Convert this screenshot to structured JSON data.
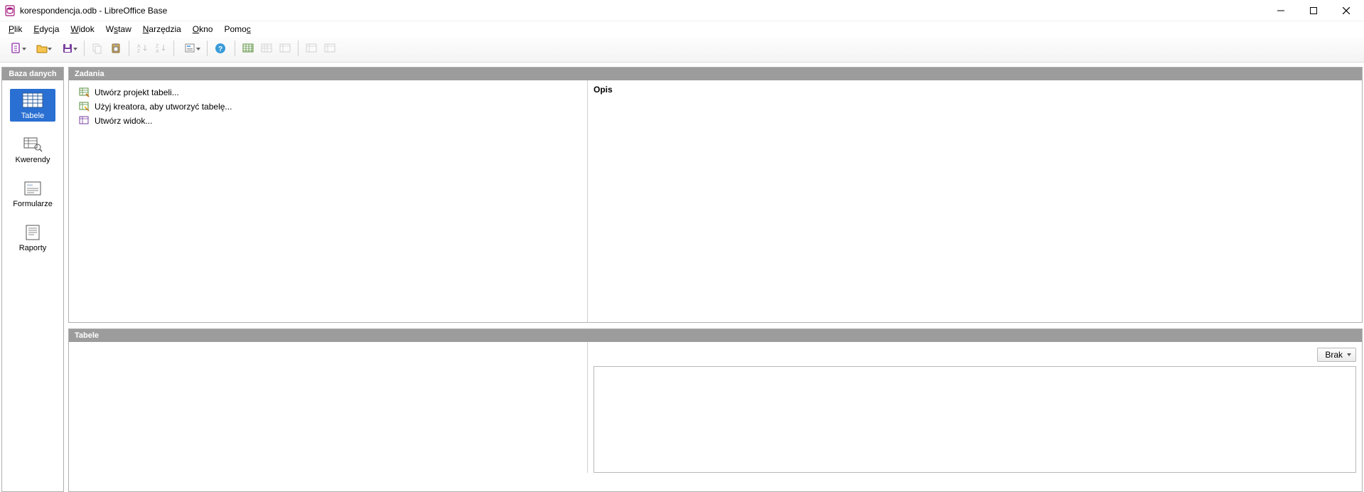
{
  "window": {
    "title": "korespondencja.odb - LibreOffice Base"
  },
  "menu": {
    "file": "Plik",
    "edit": "Edycja",
    "view": "Widok",
    "insert": "Wstaw",
    "tools": "Narzędzia",
    "window": "Okno",
    "help": "Pomoc"
  },
  "sidebar": {
    "header": "Baza danych",
    "cats": {
      "tables": "Tabele",
      "queries": "Kwerendy",
      "forms": "Formularze",
      "reports": "Raporty"
    }
  },
  "tasks_panel": {
    "header": "Zadania",
    "items": [
      "Utwórz projekt tabeli...",
      "Użyj kreatora, aby utworzyć tabelę...",
      "Utwórz widok..."
    ],
    "description_header": "Opis"
  },
  "tables_panel": {
    "header": "Tabele",
    "preview_mode": "Brak"
  },
  "icons": {
    "new": "new-doc-icon",
    "open": "open-folder-icon",
    "save": "save-icon",
    "copy": "copy-icon",
    "paste": "paste-icon",
    "sort_asc": "sort-asc-icon",
    "sort_desc": "sort-desc-icon",
    "form": "form-icon",
    "help": "help-icon",
    "table_new": "table-new-icon",
    "table_wizard": "table-wizard-icon",
    "table_open": "table-open-icon",
    "table_edit": "table-edit-icon",
    "table_delete": "table-delete-icon"
  }
}
